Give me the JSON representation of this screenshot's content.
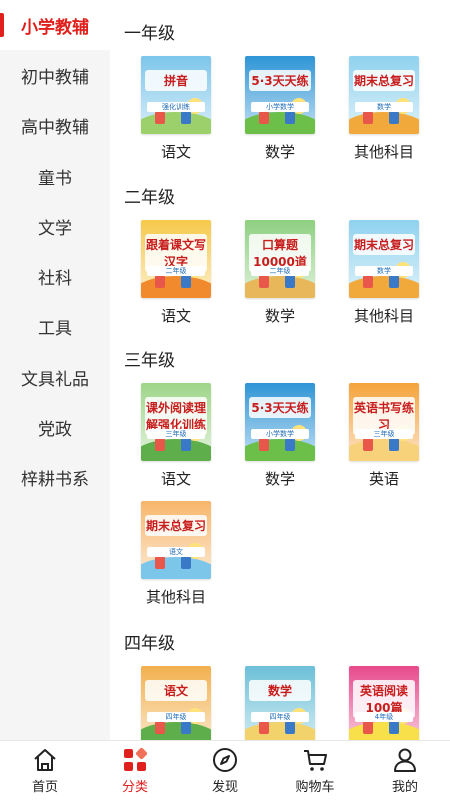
{
  "sidebar": {
    "items": [
      {
        "label": "小学教辅",
        "active": true
      },
      {
        "label": "初中教辅"
      },
      {
        "label": "高中教辅"
      },
      {
        "label": "童书"
      },
      {
        "label": "文学"
      },
      {
        "label": "社科"
      },
      {
        "label": "工具"
      },
      {
        "label": "文具礼品"
      },
      {
        "label": "党政"
      },
      {
        "label": "梓耕书系"
      }
    ]
  },
  "grades": [
    {
      "title": "一年级",
      "books": [
        {
          "label": "语文",
          "cover_text": "拼音",
          "cover_sub": "强化训练",
          "theme": "#7cc6ea",
          "accent": "#9bd06b"
        },
        {
          "label": "数学",
          "cover_text": "5·3天天练",
          "cover_sub": "小学数学",
          "theme": "#2e95d6",
          "accent": "#6cc04a"
        },
        {
          "label": "其他科目",
          "cover_text": "期末总复习",
          "cover_sub": "数学",
          "theme": "#8fd2ee",
          "accent": "#f2a93b"
        }
      ]
    },
    {
      "title": "二年级",
      "books": [
        {
          "label": "语文",
          "cover_text": "跟着课文写汉字",
          "cover_sub": "二年级",
          "theme": "#f6c94a",
          "accent": "#f08a2c"
        },
        {
          "label": "数学",
          "cover_text": "口算题10000道",
          "cover_sub": "二年级",
          "theme": "#8ed081",
          "accent": "#e7b75a"
        },
        {
          "label": "其他科目",
          "cover_text": "期末总复习",
          "cover_sub": "数学",
          "theme": "#8fd2ee",
          "accent": "#f2a93b"
        }
      ]
    },
    {
      "title": "三年级",
      "books": [
        {
          "label": "语文",
          "cover_text": "课外阅读理解强化训练",
          "cover_sub": "三年级",
          "theme": "#9fd58a",
          "accent": "#5fae4c"
        },
        {
          "label": "数学",
          "cover_text": "5·3天天练",
          "cover_sub": "小学数学",
          "theme": "#2e95d6",
          "accent": "#6cc04a"
        },
        {
          "label": "英语",
          "cover_text": "英语书写练习",
          "cover_sub": "三年级",
          "theme": "#f5a33b",
          "accent": "#f7d27a"
        },
        {
          "label": "其他科目",
          "cover_text": "期末总复习",
          "cover_sub": "语文",
          "theme": "#f7b66a",
          "accent": "#7cc6ea"
        }
      ]
    },
    {
      "title": "四年级",
      "books": [
        {
          "label": "",
          "cover_text": "语文",
          "cover_sub": "四年级",
          "theme": "#f2b04d",
          "accent": "#5fae4c"
        },
        {
          "label": "",
          "cover_text": "数学",
          "cover_sub": "四年级",
          "theme": "#6cc0d8",
          "accent": "#f2d26a"
        },
        {
          "label": "",
          "cover_text": "英语阅读100篇",
          "cover_sub": "4年级",
          "theme": "#e84a8c",
          "accent": "#f7e04a"
        }
      ]
    }
  ],
  "tabbar": {
    "items": [
      {
        "label": "首页",
        "icon": "home-icon"
      },
      {
        "label": "分类",
        "icon": "category-icon",
        "active": true
      },
      {
        "label": "发现",
        "icon": "compass-icon"
      },
      {
        "label": "购物车",
        "icon": "cart-icon"
      },
      {
        "label": "我的",
        "icon": "user-icon"
      }
    ]
  },
  "colors": {
    "accent": "#e0201c",
    "sidebar_bg": "#f5f5f5"
  }
}
